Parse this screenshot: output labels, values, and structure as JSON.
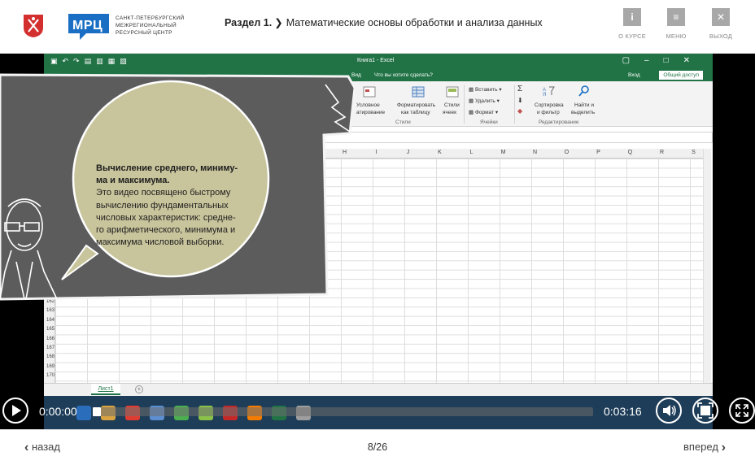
{
  "header": {
    "logo": "МРЦ",
    "org_lines": [
      "САНКТ-ПЕТЕРБУРГСКИЙ",
      "МЕЖРЕГИОНАЛЬНЫЙ",
      "РЕСУРСНЫЙ ЦЕНТР"
    ],
    "section": "Раздел 1.",
    "title": "Математические основы обработки и анализа данных",
    "buttons": {
      "about": {
        "icon": "i",
        "label": "О КУРСЕ"
      },
      "menu": {
        "icon": "≡",
        "label": "МЕНЮ"
      },
      "exit": {
        "icon": "✕",
        "label": "ВЫХОД"
      }
    },
    "colors": {
      "brand_blue": "#1a6fc4",
      "crest_red": "#d32f2f",
      "button_gray": "#a8a8a8"
    }
  },
  "excel": {
    "window_title": "Книга1 - Excel",
    "tabs": [
      "Вид"
    ],
    "tell_me": "Что вы хотите сделать?",
    "sign_in": "Вход",
    "share": "Общий доступ",
    "ribbon": {
      "cond_format": "Условное",
      "cond_format2": "атирование",
      "format_table": "Форматировать",
      "format_table2": "как таблицу",
      "cell_styles": "Стили",
      "cell_styles2": "ячеек",
      "insert": "Вставить",
      "delete": "Удалить",
      "format": "Формат",
      "sort": "Сортировка",
      "sort2": "и фильтр",
      "find": "Найти и",
      "find2": "выделить",
      "group_styles": "Стили",
      "group_cells": "Ячейки",
      "group_editing": "Редактирование"
    },
    "columns": [
      "H",
      "I",
      "J",
      "K",
      "L",
      "M",
      "N",
      "O",
      "P",
      "Q",
      "R",
      "S"
    ],
    "rows": [
      "162",
      "163",
      "164",
      "165",
      "166",
      "167",
      "168",
      "169",
      "170"
    ],
    "sheet_tab": "Лист1",
    "accent": "#217346"
  },
  "speech": {
    "title_lines": [
      "Вычисление среднего, миниму-",
      "ма и максимума."
    ],
    "body_lines": [
      "Это видео посвящено быстрому",
      "вычислению фундаментальных",
      "числовых характеристик: средне-",
      "го арифметического, минимума и",
      "максимума числовой выборки."
    ]
  },
  "player": {
    "current_time": "0:00:00",
    "duration": "0:03:16",
    "progress_fraction": 0.0
  },
  "footer": {
    "prev_label": "назад",
    "next_label": "вперед",
    "page": "8/26"
  }
}
